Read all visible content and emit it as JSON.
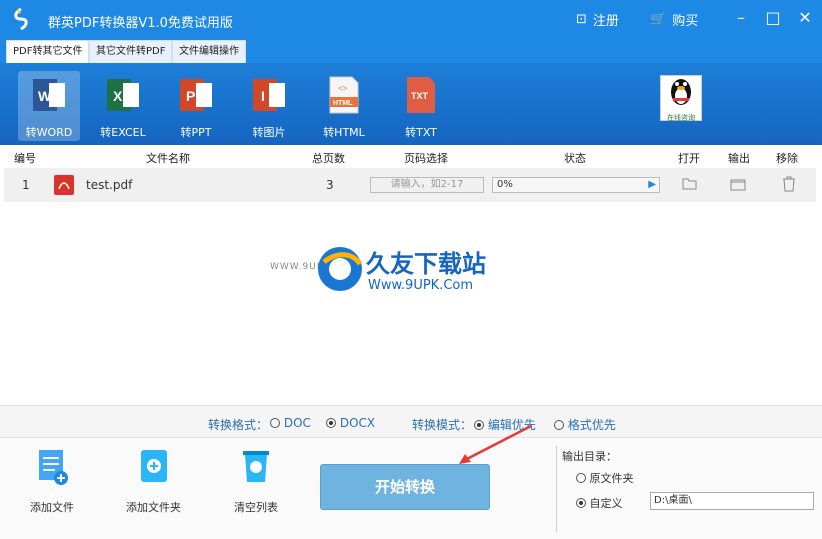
{
  "window": {
    "title": "群英PDF转换器V1.0免费试用版",
    "register": "注册",
    "buy": "购买"
  },
  "tabs": [
    "PDF转其它文件",
    "其它文件转PDF",
    "文件编辑操作"
  ],
  "tools": [
    {
      "label": "转WORD",
      "badge": "W",
      "color": "#2b5797"
    },
    {
      "label": "转EXCEL",
      "badge": "X",
      "color": "#1e7145"
    },
    {
      "label": "转PPT",
      "badge": "P",
      "color": "#d24726"
    },
    {
      "label": "转图片",
      "badge": "I",
      "color": "#d24726"
    },
    {
      "label": "转HTML",
      "badge": "HTML",
      "color": "#e8743b"
    },
    {
      "label": "转TXT",
      "badge": "TXT",
      "color": "#e05d44"
    }
  ],
  "qq_label": "在线咨询",
  "table": {
    "headers": {
      "num": "编号",
      "name": "文件名称",
      "pages": "总页数",
      "range": "页码选择",
      "status": "状态",
      "open": "打开",
      "output": "输出",
      "remove": "移除"
    },
    "rows": [
      {
        "num": "1",
        "name": "test.pdf",
        "pages": "3",
        "range_placeholder": "请输入，如2-17",
        "progress": "0%"
      }
    ]
  },
  "watermark": {
    "text": "久友下载站",
    "url": "Www.9UPK.Com",
    "prefix": "WWW.9UPK.COM"
  },
  "options": {
    "format_label": "转换格式：",
    "format_options": [
      "DOC",
      "DOCX"
    ],
    "format_selected": "DOCX",
    "mode_label": "转换模式：",
    "mode_options": [
      "编辑优先",
      "格式优先"
    ],
    "mode_selected": "编辑优先"
  },
  "bottom": {
    "add_file": "添加文件",
    "add_folder": "添加文件夹",
    "clear_list": "清空列表",
    "start": "开始转换",
    "outdir_label": "输出目录：",
    "outdir_options": [
      "原文件夹",
      "自定义"
    ],
    "outdir_selected": "自定义",
    "outdir_path": "D:\\桌面\\"
  }
}
